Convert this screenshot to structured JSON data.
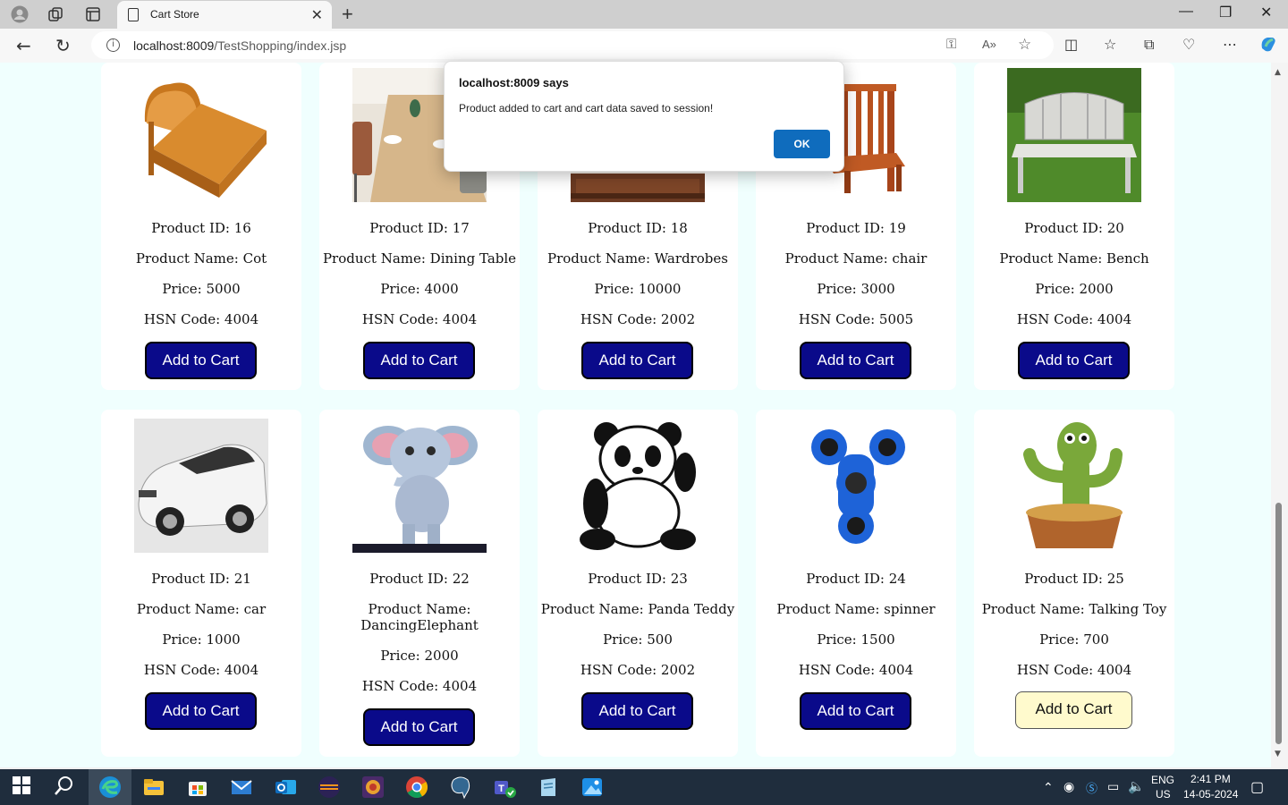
{
  "browser": {
    "tab_title": "Cart Store",
    "url_host": "localhost:8009",
    "url_path": "/TestShopping/index.jsp"
  },
  "dialog": {
    "title": "localhost:8009 says",
    "message": "Product added to cart and cart data saved to session!",
    "ok_label": "OK"
  },
  "products": [
    {
      "id_text": "Product ID: 16",
      "name_text": "Product Name: Cot",
      "price_text": "Price: 5000",
      "hsn_text": "HSN Code: 4004",
      "button": "Add to Cart",
      "image": "bed-image"
    },
    {
      "id_text": "Product ID: 17",
      "name_text": "Product Name: Dining Table",
      "price_text": "Price: 4000",
      "hsn_text": "HSN Code: 4004",
      "button": "Add to Cart",
      "image": "dining-table-image"
    },
    {
      "id_text": "Product ID: 18",
      "name_text": "Product Name: Wardrobes",
      "price_text": "Price: 10000",
      "hsn_text": "HSN Code: 2002",
      "button": "Add to Cart",
      "image": "wardrobe-image"
    },
    {
      "id_text": "Product ID: 19",
      "name_text": "Product Name: chair",
      "price_text": "Price: 3000",
      "hsn_text": "HSN Code: 5005",
      "button": "Add to Cart",
      "image": "chair-image"
    },
    {
      "id_text": "Product ID: 20",
      "name_text": "Product Name: Bench",
      "price_text": "Price: 2000",
      "hsn_text": "HSN Code: 4004",
      "button": "Add to Cart",
      "image": "bench-image"
    },
    {
      "id_text": "Product ID: 21",
      "name_text": "Product Name: car",
      "price_text": "Price: 1000",
      "hsn_text": "HSN Code: 4004",
      "button": "Add to Cart",
      "image": "car-image"
    },
    {
      "id_text": "Product ID: 22",
      "name_line1": "Product Name:",
      "name_line2": "DancingElephant",
      "price_text": "Price: 2000",
      "hsn_text": "HSN Code: 4004",
      "button": "Add to Cart",
      "image": "elephant-image"
    },
    {
      "id_text": "Product ID: 23",
      "name_text": "Product Name: Panda Teddy",
      "price_text": "Price: 500",
      "hsn_text": "HSN Code: 2002",
      "button": "Add to Cart",
      "image": "panda-image"
    },
    {
      "id_text": "Product ID: 24",
      "name_text": "Product Name: spinner",
      "price_text": "Price: 1500",
      "hsn_text": "HSN Code: 4004",
      "button": "Add to Cart",
      "image": "spinner-image"
    },
    {
      "id_text": "Product ID: 25",
      "name_text": "Product Name: Talking Toy",
      "price_text": "Price: 700",
      "hsn_text": "HSN Code: 4004",
      "button": "Add to Cart",
      "image": "cactus-toy-image"
    }
  ],
  "taskbar": {
    "lang_line1": "ENG",
    "lang_line2": "US",
    "time": "2:41 PM",
    "date": "14-05-2024"
  }
}
